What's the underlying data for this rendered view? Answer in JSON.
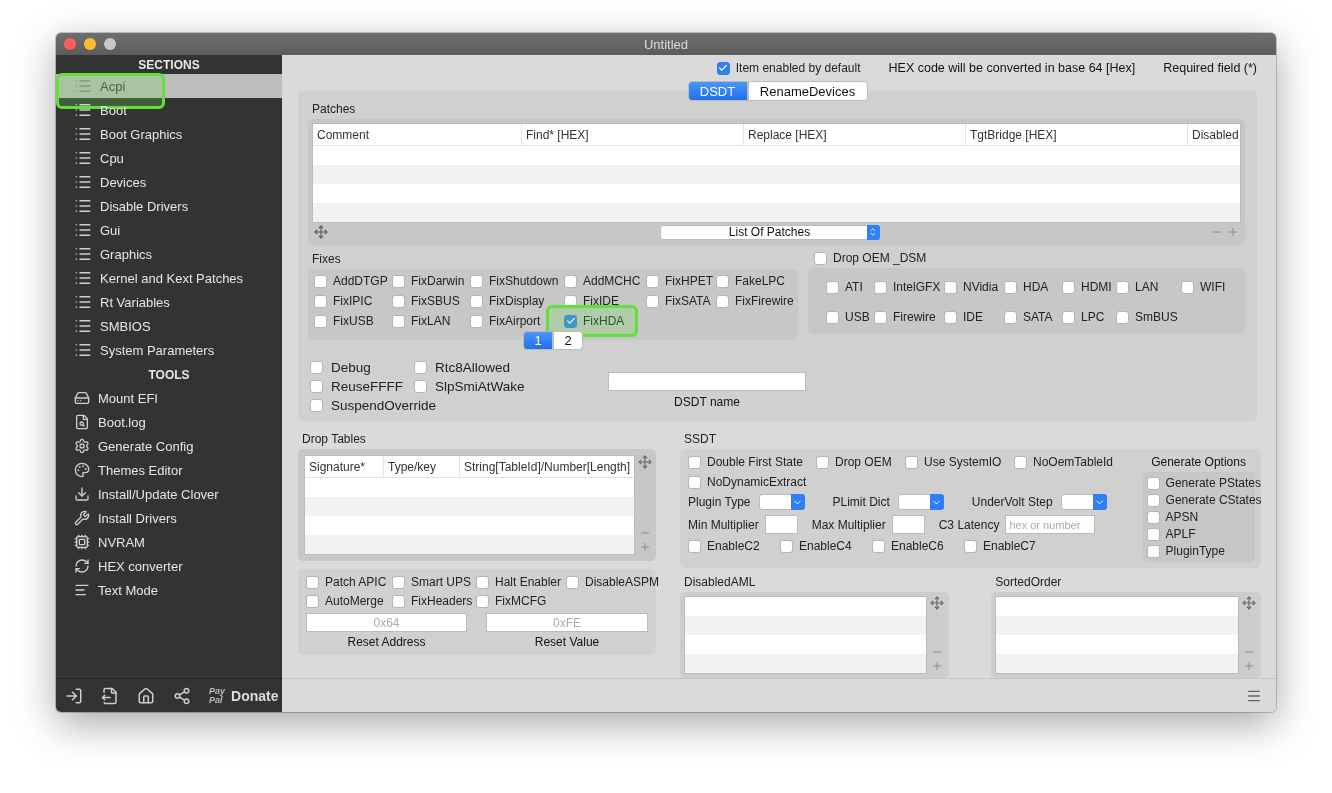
{
  "window": {
    "title": "Untitled"
  },
  "sidebar": {
    "sections_heading": "SECTIONS",
    "sections": [
      {
        "label": "Acpi",
        "selected": true,
        "highlighted": true
      },
      {
        "label": "Boot",
        "selected": false,
        "highlighted": false
      },
      {
        "label": "Boot Graphics",
        "selected": false,
        "highlighted": false
      },
      {
        "label": "Cpu",
        "selected": false,
        "highlighted": false
      },
      {
        "label": "Devices",
        "selected": false,
        "highlighted": false
      },
      {
        "label": "Disable Drivers",
        "selected": false,
        "highlighted": false
      },
      {
        "label": "Gui",
        "selected": false,
        "highlighted": false
      },
      {
        "label": "Graphics",
        "selected": false,
        "highlighted": false
      },
      {
        "label": "Kernel and Kext Patches",
        "selected": false,
        "highlighted": false
      },
      {
        "label": "Rt Variables",
        "selected": false,
        "highlighted": false
      },
      {
        "label": "SMBIOS",
        "selected": false,
        "highlighted": false
      },
      {
        "label": "System Parameters",
        "selected": false,
        "highlighted": false
      }
    ],
    "tools_heading": "TOOLS",
    "tools": [
      {
        "label": "Mount EFI",
        "kind": "disk"
      },
      {
        "label": "Boot.log",
        "kind": "log"
      },
      {
        "label": "Generate Config",
        "kind": "gears"
      },
      {
        "label": "Themes Editor",
        "kind": "palette"
      },
      {
        "label": "Install/Update Clover",
        "kind": "download"
      },
      {
        "label": "Install Drivers",
        "kind": "tools"
      },
      {
        "label": "NVRAM",
        "kind": "chip"
      },
      {
        "label": "HEX converter",
        "kind": "refresh"
      },
      {
        "label": "Text Mode",
        "kind": "text"
      }
    ],
    "footer": {
      "paypal": [
        "Pay",
        "Pal"
      ],
      "donate": "Donate"
    }
  },
  "header": {
    "enabled_default": {
      "label": "Item enabled by default",
      "checked": true
    },
    "hex_note": "HEX code will be converted in base 64 [Hex]",
    "required_note": "Required field (*)"
  },
  "tabs": [
    {
      "label": "DSDT",
      "selected": true
    },
    {
      "label": "RenameDevices",
      "selected": false
    }
  ],
  "patches": {
    "title": "Patches",
    "columns": [
      "Comment",
      "Find* [HEX]",
      "Replace [HEX]",
      "TgtBridge [HEX]",
      "Disabled"
    ],
    "list_popup": "List Of Patches"
  },
  "fixes": {
    "title": "Fixes",
    "items": [
      {
        "label": "AddDTGP",
        "checked": false,
        "highlighted": false
      },
      {
        "label": "FixDarwin",
        "checked": false,
        "highlighted": false
      },
      {
        "label": "FixShutdown",
        "checked": false,
        "highlighted": false
      },
      {
        "label": "AddMCHC",
        "checked": false,
        "highlighted": false
      },
      {
        "label": "FixHPET",
        "checked": false,
        "highlighted": false
      },
      {
        "label": "FakeLPC",
        "checked": false,
        "highlighted": false
      },
      {
        "label": "FixIPIC",
        "checked": false,
        "highlighted": false
      },
      {
        "label": "FixSBUS",
        "checked": false,
        "highlighted": false
      },
      {
        "label": "FixDisplay",
        "checked": false,
        "highlighted": false
      },
      {
        "label": "FixIDE",
        "checked": false,
        "highlighted": false
      },
      {
        "label": "FixSATA",
        "checked": false,
        "highlighted": false
      },
      {
        "label": "FixFirewire",
        "checked": false,
        "highlighted": false
      },
      {
        "label": "FixUSB",
        "checked": false,
        "highlighted": false
      },
      {
        "label": "FixLAN",
        "checked": false,
        "highlighted": false
      },
      {
        "label": "FixAirport",
        "checked": false,
        "highlighted": false
      },
      {
        "label": "FixHDA",
        "checked": true,
        "highlighted": true
      }
    ],
    "pages": [
      {
        "label": "1",
        "selected": true
      },
      {
        "label": "2",
        "selected": false
      }
    ]
  },
  "drop_oem": {
    "label": "Drop OEM _DSM",
    "checked": false,
    "items": [
      {
        "label": "ATI",
        "checked": false
      },
      {
        "label": "IntelGFX",
        "checked": false
      },
      {
        "label": "NVidia",
        "checked": false
      },
      {
        "label": "HDA",
        "checked": false
      },
      {
        "label": "HDMI",
        "checked": false
      },
      {
        "label": "LAN",
        "checked": false
      },
      {
        "label": "WIFI",
        "checked": false
      },
      {
        "label": "USB",
        "checked": false
      },
      {
        "label": "Firewire",
        "checked": false
      },
      {
        "label": "IDE",
        "checked": false
      },
      {
        "label": "SATA",
        "checked": false
      },
      {
        "label": "LPC",
        "checked": false
      },
      {
        "label": "SmBUS",
        "checked": false
      }
    ]
  },
  "options": [
    {
      "label": "Debug",
      "checked": false
    },
    {
      "label": "Rtc8Allowed",
      "checked": false
    },
    {
      "label": "ReuseFFFF",
      "checked": false
    },
    {
      "label": "SlpSmiAtWake",
      "checked": false
    },
    {
      "label": "SuspendOverride",
      "checked": false
    }
  ],
  "dsdt_name": {
    "label": "DSDT name"
  },
  "drop_tables": {
    "title": "Drop Tables",
    "columns": [
      "Signature*",
      "Type/key",
      "String[TableId]/Number[Length]"
    ]
  },
  "misc": {
    "items": [
      {
        "label": "Patch APIC",
        "checked": false
      },
      {
        "label": "Smart UPS",
        "checked": false
      },
      {
        "label": "Halt Enabler",
        "checked": false
      },
      {
        "label": "DisableASPM",
        "checked": false
      },
      {
        "label": "AutoMerge",
        "checked": false
      },
      {
        "label": "FixHeaders",
        "checked": false
      },
      {
        "label": "FixMCFG",
        "checked": false
      }
    ],
    "reset_address": {
      "placeholder": "0x64",
      "label": "Reset Address"
    },
    "reset_value": {
      "placeholder": "0xFE",
      "label": "Reset Value"
    }
  },
  "ssdt": {
    "title": "SSDT",
    "checks": [
      {
        "label": "Double First State",
        "checked": false
      },
      {
        "label": "Drop OEM",
        "checked": false
      },
      {
        "label": "Use SystemIO",
        "checked": false
      },
      {
        "label": "NoOemTableId",
        "checked": false
      },
      {
        "label": "NoDynamicExtract",
        "checked": false
      }
    ],
    "selects": [
      {
        "label": "Plugin Type"
      },
      {
        "label": "PLimit Dict"
      },
      {
        "label": "UnderVolt Step"
      }
    ],
    "fields": [
      {
        "label": "Min Multiplier"
      },
      {
        "label": "Max Multiplier"
      },
      {
        "label": "C3 Latency",
        "placeholder": "hex or number"
      }
    ],
    "cstates": [
      {
        "label": "EnableC2",
        "checked": false
      },
      {
        "label": "EnableC4",
        "checked": false
      },
      {
        "label": "EnableC6",
        "checked": false
      },
      {
        "label": "EnableC7",
        "checked": false
      }
    ],
    "generate": {
      "title": "Generate Options",
      "items": [
        {
          "label": "Generate PStates",
          "checked": false
        },
        {
          "label": "Generate CStates",
          "checked": false
        },
        {
          "label": "APSN",
          "checked": false
        },
        {
          "label": "APLF",
          "checked": false
        },
        {
          "label": "PluginType",
          "checked": false
        }
      ]
    }
  },
  "disabled_aml": {
    "title": "DisabledAML"
  },
  "sorted_order": {
    "title": "SortedOrder"
  }
}
